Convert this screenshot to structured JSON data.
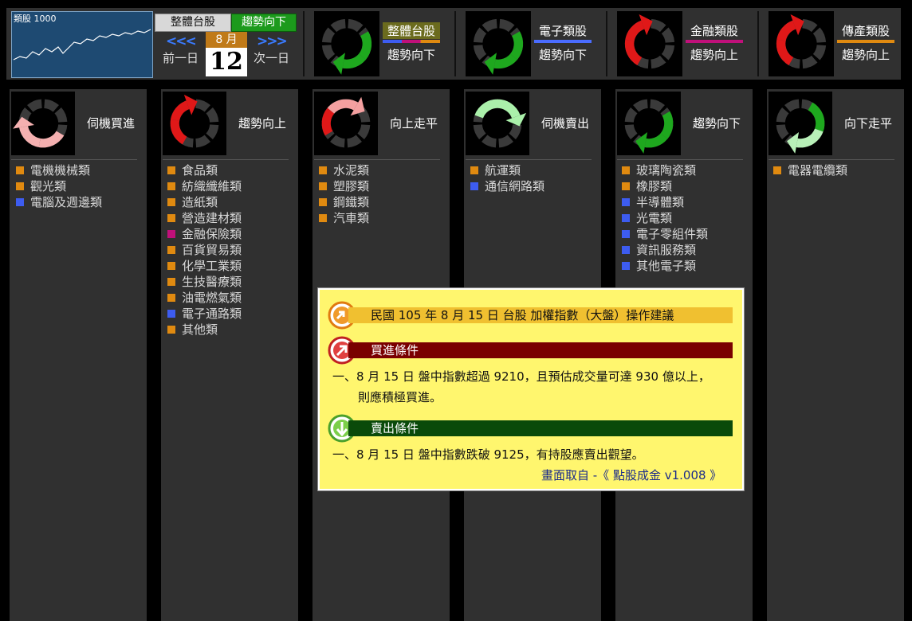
{
  "mini_chart": {
    "label": "類股 1000"
  },
  "top": {
    "overall_label": "整體台股",
    "overall_trend": "趨勢向下",
    "prev_arrows": "<<<",
    "next_arrows": ">>>",
    "prev_day": "前一日",
    "next_day": "次一日",
    "month": "8 月",
    "day": "12"
  },
  "sectors": [
    {
      "name": "整體台股",
      "status": "趨勢向下",
      "icon": "cycle-down-green-icon",
      "highlight": "#6b6b1e"
    },
    {
      "name": "電子類股",
      "status": "趨勢向下",
      "icon": "cycle-down-green-icon",
      "bar_color": "#4a6cff"
    },
    {
      "name": "金融類股",
      "status": "趨勢向上",
      "icon": "cycle-up-red-icon",
      "bar_color": "#c0107a"
    },
    {
      "name": "傳產類股",
      "status": "趨勢向上",
      "icon": "cycle-up-red-icon",
      "bar_color": "#e08a10"
    }
  ],
  "colors": {
    "orange": "#e08a10",
    "blue": "#3d5cf0",
    "magenta": "#c0107a"
  },
  "columns": [
    {
      "title": "伺機買進",
      "icon": "cycle-buy-pink-icon",
      "items": [
        {
          "label": "電機機械類",
          "color": "orange"
        },
        {
          "label": "觀光類",
          "color": "orange"
        },
        {
          "label": "電腦及週邊類",
          "color": "blue"
        }
      ]
    },
    {
      "title": "趨勢向上",
      "icon": "cycle-up-red-icon",
      "items": [
        {
          "label": "食品類",
          "color": "orange"
        },
        {
          "label": "紡織纖維類",
          "color": "orange"
        },
        {
          "label": "造紙類",
          "color": "orange"
        },
        {
          "label": "營造建材類",
          "color": "orange"
        },
        {
          "label": "金融保險類",
          "color": "magenta"
        },
        {
          "label": "百貨貿易類",
          "color": "orange"
        },
        {
          "label": "化學工業類",
          "color": "orange"
        },
        {
          "label": "生技醫療類",
          "color": "orange"
        },
        {
          "label": "油電燃氣類",
          "color": "orange"
        },
        {
          "label": "電子通路類",
          "color": "blue"
        },
        {
          "label": "其他類",
          "color": "orange"
        }
      ]
    },
    {
      "title": "向上走平",
      "icon": "cycle-flat-up-icon",
      "items": [
        {
          "label": "水泥類",
          "color": "orange"
        },
        {
          "label": "塑膠類",
          "color": "orange"
        },
        {
          "label": "鋼鐵類",
          "color": "orange"
        },
        {
          "label": "汽車類",
          "color": "orange"
        }
      ]
    },
    {
      "title": "伺機賣出",
      "icon": "cycle-sell-lightgreen-icon",
      "items": [
        {
          "label": "航運類",
          "color": "orange"
        },
        {
          "label": "通信網路類",
          "color": "blue"
        }
      ]
    },
    {
      "title": "趨勢向下",
      "icon": "cycle-down-green-icon",
      "items": [
        {
          "label": "玻璃陶瓷類",
          "color": "orange"
        },
        {
          "label": "橡膠類",
          "color": "orange"
        },
        {
          "label": "半導體類",
          "color": "blue"
        },
        {
          "label": "光電類",
          "color": "blue"
        },
        {
          "label": "電子零組件類",
          "color": "blue"
        },
        {
          "label": "資訊服務類",
          "color": "blue"
        },
        {
          "label": "其他電子類",
          "color": "blue"
        }
      ]
    },
    {
      "title": "向下走平",
      "icon": "cycle-flat-down-icon",
      "items": [
        {
          "label": "電器電纜類",
          "color": "orange"
        }
      ]
    }
  ],
  "popup": {
    "header": "民國 105 年 8 月 15 日 台股 加權指數（大盤）操作建議",
    "buy_title": "買進條件",
    "buy_line1": "一、8 月 15 日 盤中指數超過 9210，且預估成交量可達 930 億以上，",
    "buy_line2": "則應積極買進。",
    "sell_title": "賣出條件",
    "sell_line1": "一、8 月 15 日 盤中指數跌破 9125，有持股應賣出觀望。",
    "source": "畫面取自 -《 點股成金 v1.008 》"
  }
}
